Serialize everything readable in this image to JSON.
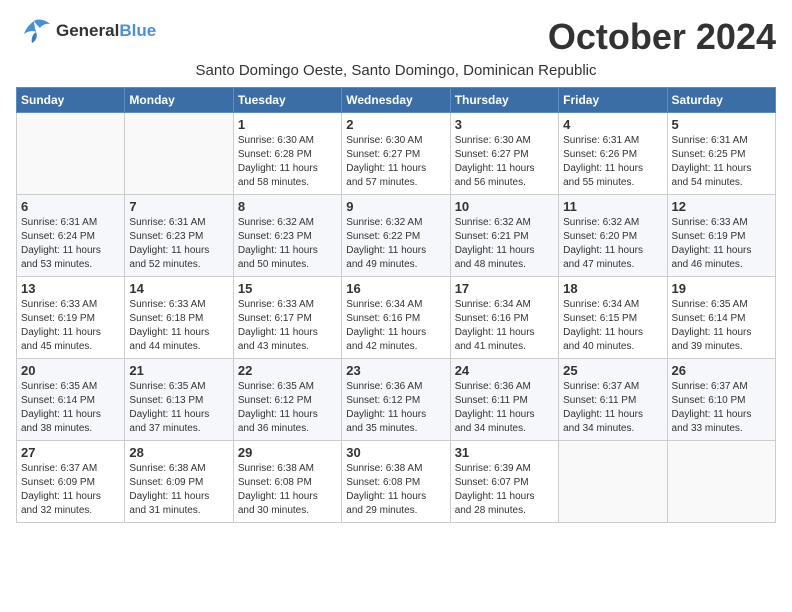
{
  "logo": {
    "line1": "General",
    "line2": "Blue"
  },
  "title": "October 2024",
  "subtitle": "Santo Domingo Oeste, Santo Domingo, Dominican Republic",
  "days_header": [
    "Sunday",
    "Monday",
    "Tuesday",
    "Wednesday",
    "Thursday",
    "Friday",
    "Saturday"
  ],
  "weeks": [
    [
      {
        "day": "",
        "info": ""
      },
      {
        "day": "",
        "info": ""
      },
      {
        "day": "1",
        "info": "Sunrise: 6:30 AM\nSunset: 6:28 PM\nDaylight: 11 hours\nand 58 minutes."
      },
      {
        "day": "2",
        "info": "Sunrise: 6:30 AM\nSunset: 6:27 PM\nDaylight: 11 hours\nand 57 minutes."
      },
      {
        "day": "3",
        "info": "Sunrise: 6:30 AM\nSunset: 6:27 PM\nDaylight: 11 hours\nand 56 minutes."
      },
      {
        "day": "4",
        "info": "Sunrise: 6:31 AM\nSunset: 6:26 PM\nDaylight: 11 hours\nand 55 minutes."
      },
      {
        "day": "5",
        "info": "Sunrise: 6:31 AM\nSunset: 6:25 PM\nDaylight: 11 hours\nand 54 minutes."
      }
    ],
    [
      {
        "day": "6",
        "info": "Sunrise: 6:31 AM\nSunset: 6:24 PM\nDaylight: 11 hours\nand 53 minutes."
      },
      {
        "day": "7",
        "info": "Sunrise: 6:31 AM\nSunset: 6:23 PM\nDaylight: 11 hours\nand 52 minutes."
      },
      {
        "day": "8",
        "info": "Sunrise: 6:32 AM\nSunset: 6:23 PM\nDaylight: 11 hours\nand 50 minutes."
      },
      {
        "day": "9",
        "info": "Sunrise: 6:32 AM\nSunset: 6:22 PM\nDaylight: 11 hours\nand 49 minutes."
      },
      {
        "day": "10",
        "info": "Sunrise: 6:32 AM\nSunset: 6:21 PM\nDaylight: 11 hours\nand 48 minutes."
      },
      {
        "day": "11",
        "info": "Sunrise: 6:32 AM\nSunset: 6:20 PM\nDaylight: 11 hours\nand 47 minutes."
      },
      {
        "day": "12",
        "info": "Sunrise: 6:33 AM\nSunset: 6:19 PM\nDaylight: 11 hours\nand 46 minutes."
      }
    ],
    [
      {
        "day": "13",
        "info": "Sunrise: 6:33 AM\nSunset: 6:19 PM\nDaylight: 11 hours\nand 45 minutes."
      },
      {
        "day": "14",
        "info": "Sunrise: 6:33 AM\nSunset: 6:18 PM\nDaylight: 11 hours\nand 44 minutes."
      },
      {
        "day": "15",
        "info": "Sunrise: 6:33 AM\nSunset: 6:17 PM\nDaylight: 11 hours\nand 43 minutes."
      },
      {
        "day": "16",
        "info": "Sunrise: 6:34 AM\nSunset: 6:16 PM\nDaylight: 11 hours\nand 42 minutes."
      },
      {
        "day": "17",
        "info": "Sunrise: 6:34 AM\nSunset: 6:16 PM\nDaylight: 11 hours\nand 41 minutes."
      },
      {
        "day": "18",
        "info": "Sunrise: 6:34 AM\nSunset: 6:15 PM\nDaylight: 11 hours\nand 40 minutes."
      },
      {
        "day": "19",
        "info": "Sunrise: 6:35 AM\nSunset: 6:14 PM\nDaylight: 11 hours\nand 39 minutes."
      }
    ],
    [
      {
        "day": "20",
        "info": "Sunrise: 6:35 AM\nSunset: 6:14 PM\nDaylight: 11 hours\nand 38 minutes."
      },
      {
        "day": "21",
        "info": "Sunrise: 6:35 AM\nSunset: 6:13 PM\nDaylight: 11 hours\nand 37 minutes."
      },
      {
        "day": "22",
        "info": "Sunrise: 6:35 AM\nSunset: 6:12 PM\nDaylight: 11 hours\nand 36 minutes."
      },
      {
        "day": "23",
        "info": "Sunrise: 6:36 AM\nSunset: 6:12 PM\nDaylight: 11 hours\nand 35 minutes."
      },
      {
        "day": "24",
        "info": "Sunrise: 6:36 AM\nSunset: 6:11 PM\nDaylight: 11 hours\nand 34 minutes."
      },
      {
        "day": "25",
        "info": "Sunrise: 6:37 AM\nSunset: 6:11 PM\nDaylight: 11 hours\nand 34 minutes."
      },
      {
        "day": "26",
        "info": "Sunrise: 6:37 AM\nSunset: 6:10 PM\nDaylight: 11 hours\nand 33 minutes."
      }
    ],
    [
      {
        "day": "27",
        "info": "Sunrise: 6:37 AM\nSunset: 6:09 PM\nDaylight: 11 hours\nand 32 minutes."
      },
      {
        "day": "28",
        "info": "Sunrise: 6:38 AM\nSunset: 6:09 PM\nDaylight: 11 hours\nand 31 minutes."
      },
      {
        "day": "29",
        "info": "Sunrise: 6:38 AM\nSunset: 6:08 PM\nDaylight: 11 hours\nand 30 minutes."
      },
      {
        "day": "30",
        "info": "Sunrise: 6:38 AM\nSunset: 6:08 PM\nDaylight: 11 hours\nand 29 minutes."
      },
      {
        "day": "31",
        "info": "Sunrise: 6:39 AM\nSunset: 6:07 PM\nDaylight: 11 hours\nand 28 minutes."
      },
      {
        "day": "",
        "info": ""
      },
      {
        "day": "",
        "info": ""
      }
    ]
  ]
}
